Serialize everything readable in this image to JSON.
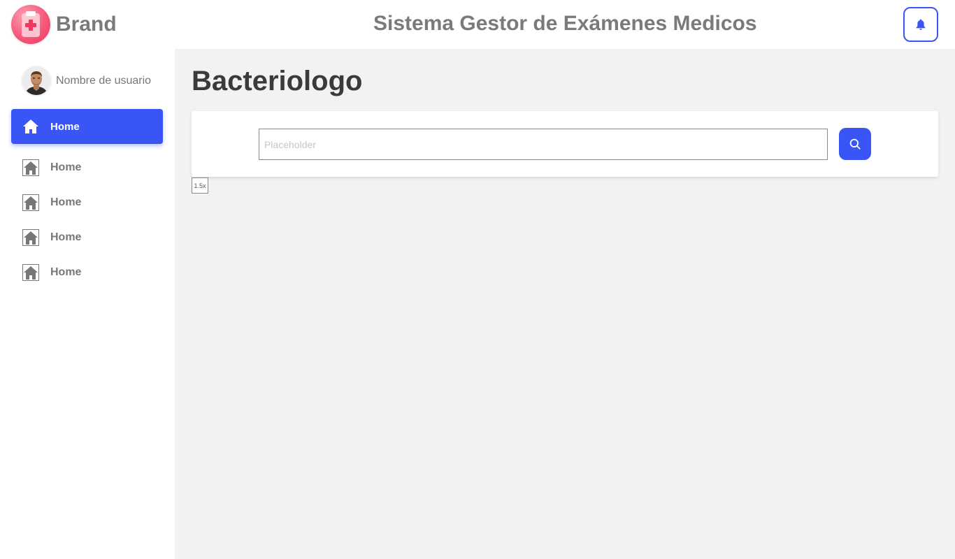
{
  "header": {
    "brand_name": "Brand",
    "logo_icon": "medical-clipboard-icon",
    "app_title": "Sistema Gestor de Exámenes Medicos",
    "notification_icon": "bell-icon"
  },
  "sidebar": {
    "user_name": "Nombre de usuario",
    "items": [
      {
        "label": "Home",
        "icon": "home-icon",
        "active": true
      },
      {
        "label": "Home",
        "icon": "home-icon",
        "active": false
      },
      {
        "label": "Home",
        "icon": "home-icon",
        "active": false
      },
      {
        "label": "Home",
        "icon": "home-icon",
        "active": false
      },
      {
        "label": "Home",
        "icon": "home-icon",
        "active": false
      }
    ]
  },
  "main": {
    "page_title": "Bacteriologo",
    "search": {
      "value": "",
      "placeholder": "Placeholder",
      "button_icon": "search-icon"
    },
    "zoom_label": "1.5x"
  },
  "colors": {
    "accent": "#3a55f5",
    "main_background": "#f2f2f2",
    "muted_text": "#777777",
    "logo": "#f6587a"
  }
}
